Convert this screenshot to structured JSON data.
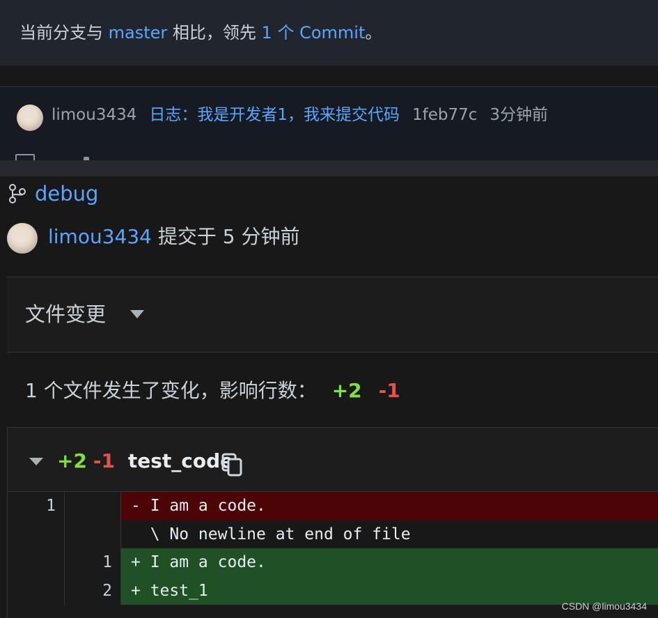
{
  "banner": {
    "prefix": "当前分支与 ",
    "branch": "master",
    "middle": " 相比，领先 ",
    "count": "1",
    "suffix_link": " 个 Commit",
    "end": "。"
  },
  "commit": {
    "author": "limou3434",
    "message": "日志：我是开发者1，我来提交代码",
    "hash": "1feb77c",
    "time": "3分钟前"
  },
  "branch": {
    "name": "debug",
    "icon": "git-branch-icon"
  },
  "author_line": {
    "author": "limou3434",
    "action": " 提交于 5 分钟前"
  },
  "file_changes": {
    "label": "文件变更"
  },
  "summary": {
    "text": "1 个文件发生了变化，影响行数：",
    "added": "+2",
    "removed": "-1"
  },
  "diff": {
    "added": "+2",
    "removed": "-1",
    "filename": "test_code",
    "rows": [
      {
        "type": "removed",
        "old": "1",
        "new": "",
        "code": "- I am a code."
      },
      {
        "type": "neutral",
        "old": "",
        "new": "",
        "code": "  \\ No newline at end of file"
      },
      {
        "type": "added",
        "old": "",
        "new": "1",
        "code": "+ I am a code."
      },
      {
        "type": "added",
        "old": "",
        "new": "2",
        "code": "+ test_1"
      }
    ]
  },
  "watermark": "CSDN @limou3434",
  "colors": {
    "link": "#58a6ff",
    "added": "#7ee23d",
    "removed": "#e5534b",
    "removed_bg": "#4c0404",
    "added_bg": "#1f5125"
  }
}
